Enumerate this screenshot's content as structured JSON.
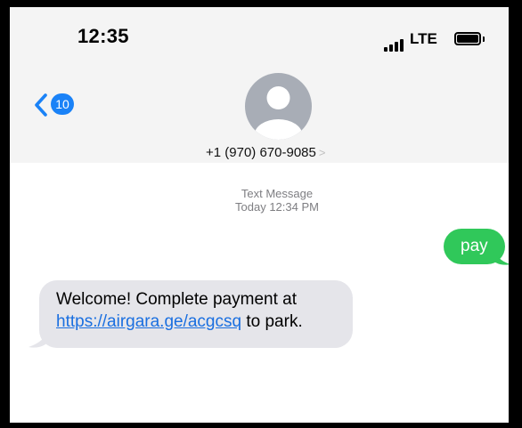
{
  "status_bar": {
    "time": "12:35",
    "network": "LTE"
  },
  "header": {
    "back_badge": "10",
    "contact": "+1 (970) 670-9085",
    "chevron": ">"
  },
  "thread": {
    "service_label": "Text Message",
    "timestamp": "Today 12:34 PM",
    "messages": [
      {
        "direction": "outgoing",
        "text": "pay"
      },
      {
        "direction": "incoming",
        "text_before": "Welcome! Complete payment at",
        "link": "https://airgara.ge/acgcsq",
        "text_after": " to park."
      }
    ]
  },
  "colors": {
    "outgoing_bubble": "#30c85a",
    "incoming_bubble": "#e5e5ea",
    "accent": "#1a82f7",
    "link": "#1a6fe0",
    "header_bg": "#f4f4f4"
  },
  "icons": [
    "back-chevron-icon",
    "contact-avatar-icon",
    "signal-bars-icon",
    "battery-icon",
    "disclosure-chevron-icon"
  ]
}
